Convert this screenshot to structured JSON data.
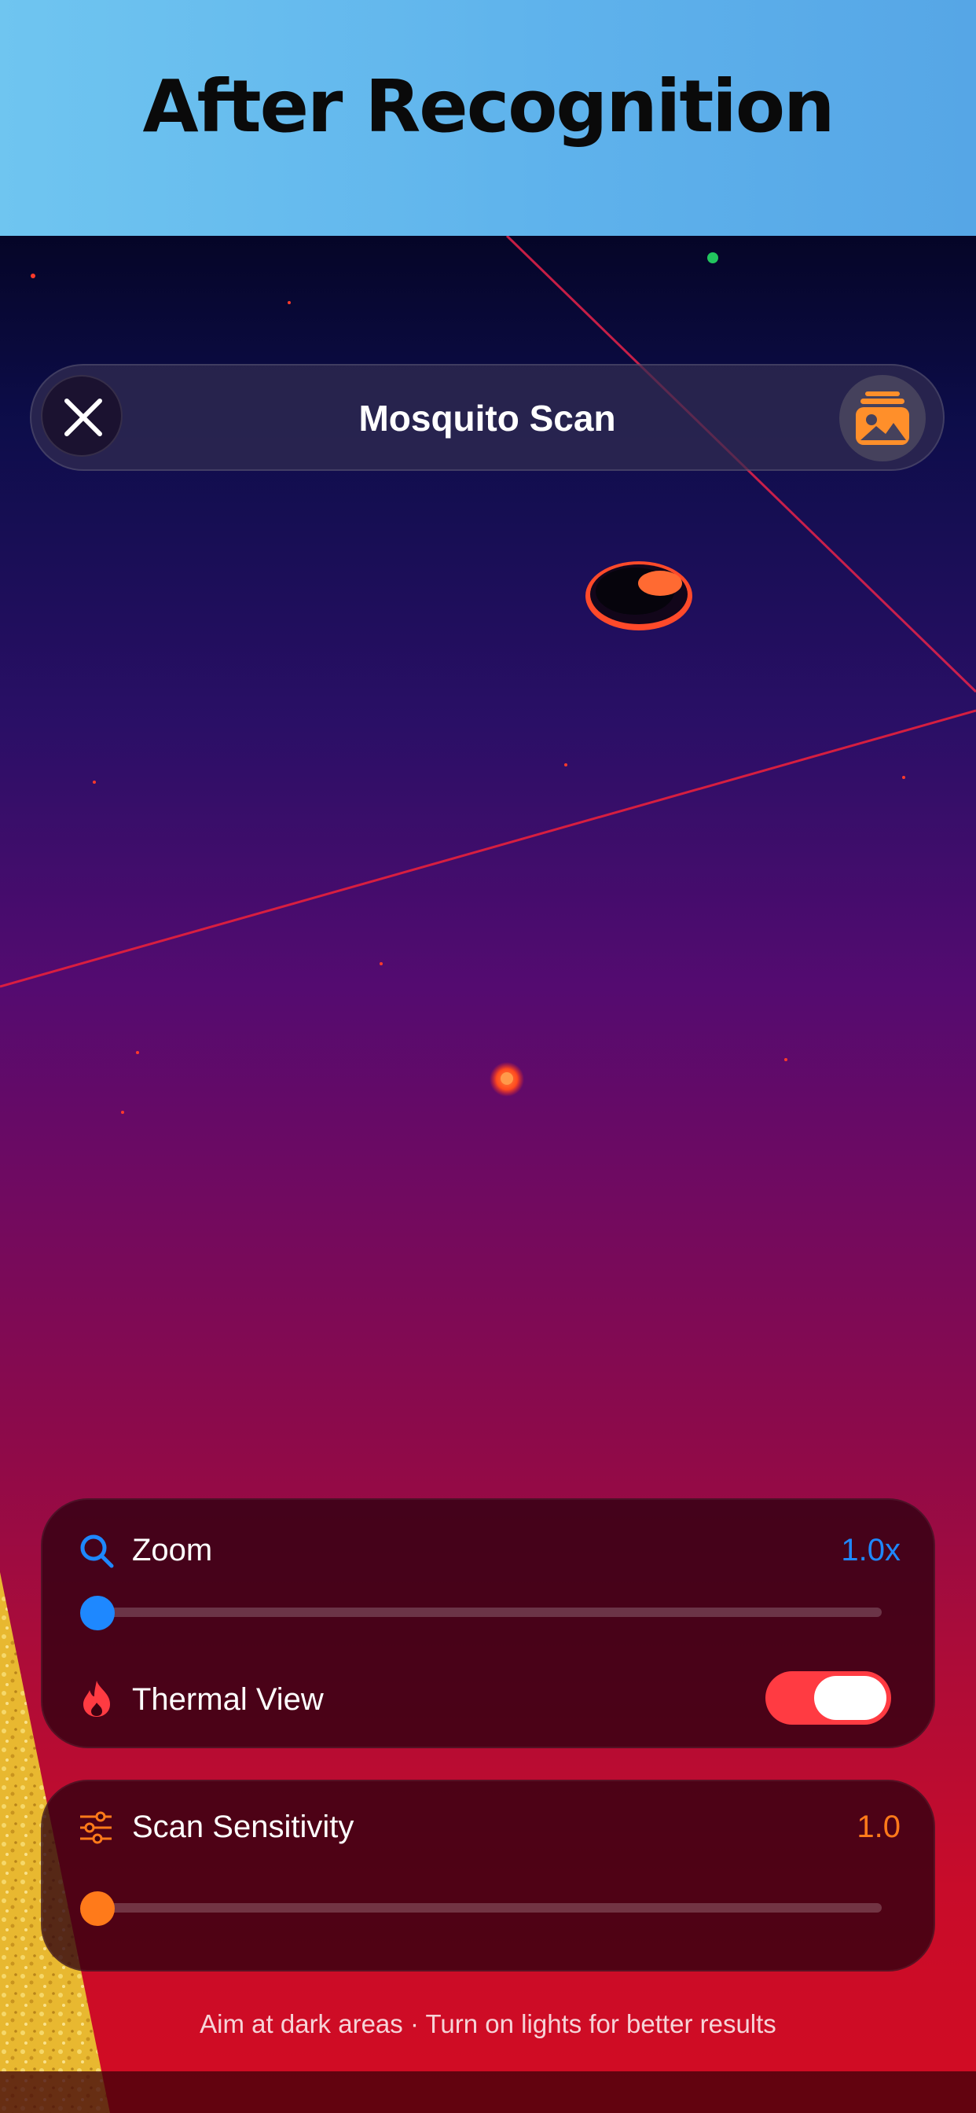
{
  "header": {
    "title": "After Recognition"
  },
  "topbar": {
    "title": "Mosquito Scan",
    "close_icon": "close-x-icon",
    "gallery_icon": "photo-gallery-icon"
  },
  "zoom": {
    "label": "Zoom",
    "value": "1.0x",
    "slider_fraction": 0.0,
    "icon": "magnifying-glass-icon",
    "accent_color": "#1e88ff"
  },
  "thermal": {
    "label": "Thermal View",
    "enabled": true,
    "icon": "flame-icon",
    "accent_color": "#ff3b42"
  },
  "sensitivity": {
    "label": "Scan Sensitivity",
    "value": "1.0",
    "slider_fraction": 0.0,
    "icon": "sliders-icon",
    "accent_color": "#ff7a1a"
  },
  "hint": {
    "text": "Aim at dark areas · Turn on lights for better results"
  },
  "colors": {
    "header_bg": "#62b8ee",
    "gallery_icon": "#ff8f2a",
    "zoom_accent": "#1e88ff",
    "sensitivity_accent": "#ff7a1a",
    "toggle_on": "#ff3b42"
  }
}
